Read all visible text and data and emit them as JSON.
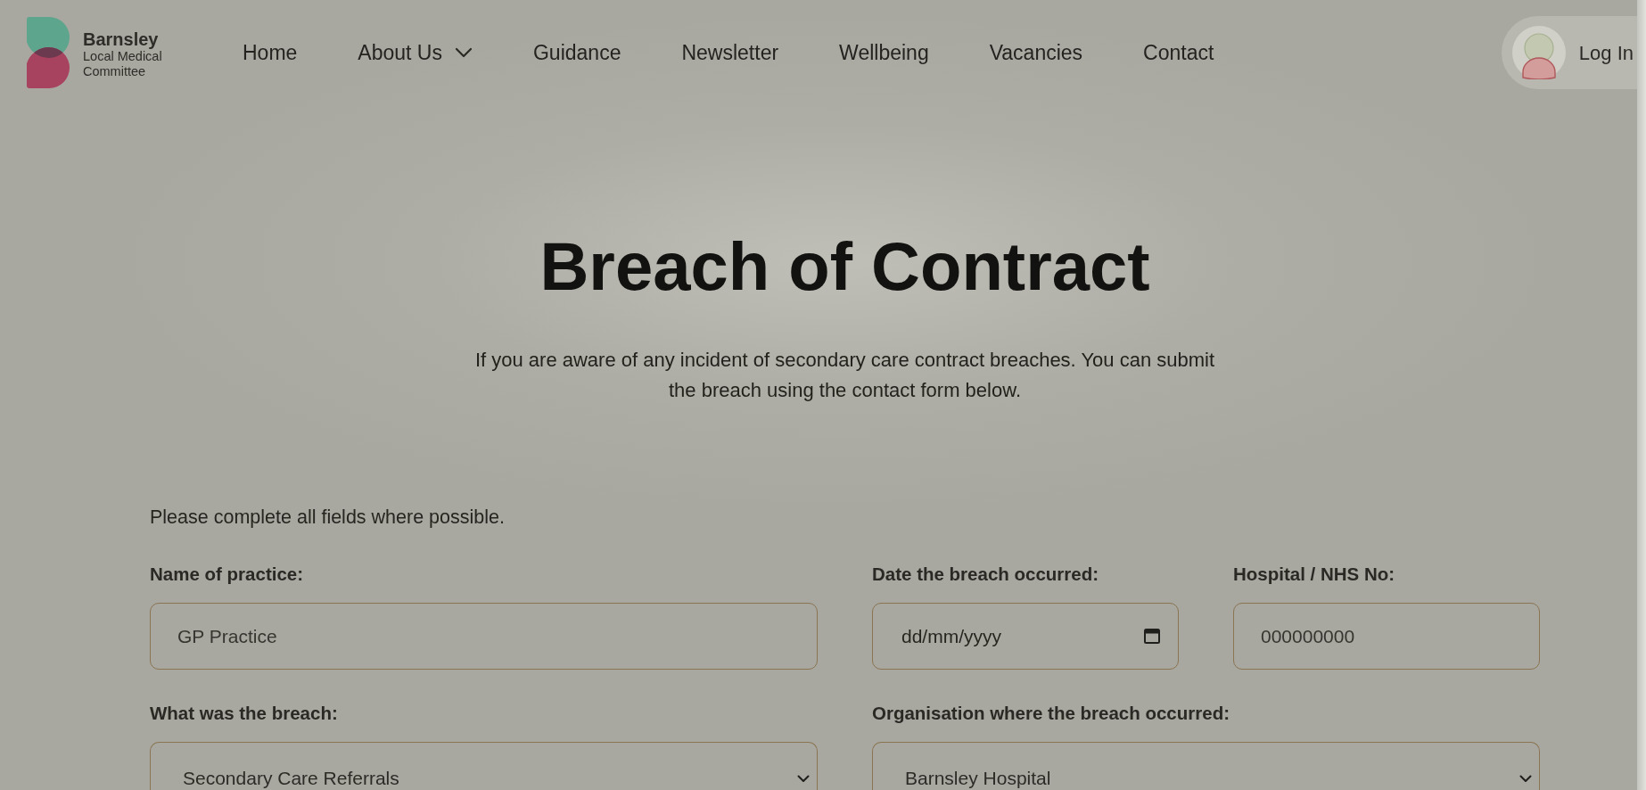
{
  "header": {
    "logo": {
      "title": "Barnsley",
      "subtitle_lines": [
        "Local Medical",
        "Committee"
      ]
    },
    "nav": [
      {
        "label": "Home",
        "dropdown": false
      },
      {
        "label": "About Us",
        "dropdown": true
      },
      {
        "label": "Guidance",
        "dropdown": false
      },
      {
        "label": "Newsletter",
        "dropdown": false
      },
      {
        "label": "Wellbeing",
        "dropdown": false
      },
      {
        "label": "Vacancies",
        "dropdown": false
      },
      {
        "label": "Contact",
        "dropdown": false
      }
    ],
    "login": {
      "label": "Log In"
    }
  },
  "hero": {
    "title": "Breach of Contract",
    "intro": "If you are aware of any incident of secondary care contract breaches. You can submit the breach using the contact form below."
  },
  "form": {
    "instructions": "Please complete all fields where possible.",
    "rows": [
      [
        {
          "kind": "text",
          "label": "Name of practice:",
          "placeholder": "GP Practice"
        },
        {
          "kind": "date",
          "label": "Date the breach occurred:",
          "placeholder": "dd/mm/yyyy"
        },
        {
          "kind": "text",
          "label": "Hospital / NHS No:",
          "placeholder": "000000000"
        }
      ],
      [
        {
          "kind": "select",
          "label": "What was the breach:",
          "value": "Secondary Care Referrals"
        },
        {
          "kind": "select",
          "label": "Organisation where the breach occurred:",
          "value": "Barnsley Hospital"
        }
      ]
    ]
  }
}
